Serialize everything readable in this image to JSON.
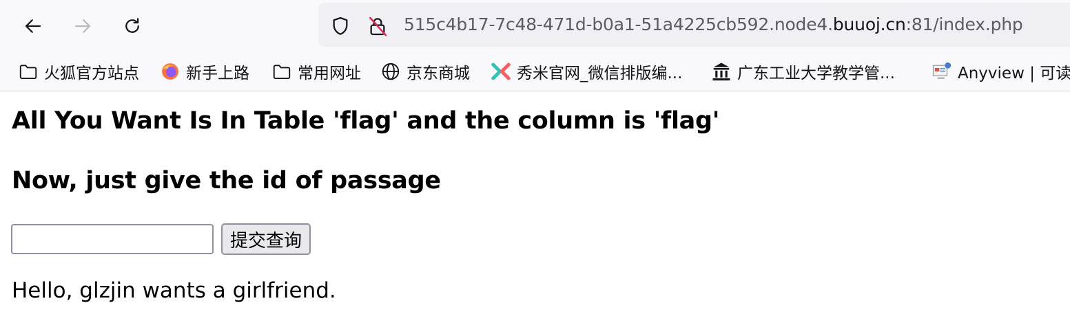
{
  "browser": {
    "url": {
      "prefix": "515c4b17-7c48-471d-b0a1-51a4225cb592.node4.",
      "host": "buuoj.cn",
      "suffix": ":81/index.php"
    },
    "icons": {
      "back": "arrow-left-icon",
      "forward": "arrow-right-icon",
      "reload": "reload-icon",
      "tracking": "shield-icon",
      "insecure": "insecure-lock-icon"
    }
  },
  "bookmarks": [
    {
      "label": "火狐官方站点",
      "icon": "folder-icon"
    },
    {
      "label": "新手上路",
      "icon": "firefox-icon"
    },
    {
      "label": "常用网址",
      "icon": "folder-icon"
    },
    {
      "label": "京东商城",
      "icon": "globe-icon"
    },
    {
      "label": "秀米官网_微信排版编...",
      "icon": "xiumi-icon"
    },
    {
      "label": "广东工业大学教学管...",
      "icon": "university-icon"
    },
    {
      "label": "Anyview | 可读",
      "icon": "anyview-icon"
    }
  ],
  "page": {
    "heading1": "All You Want Is In Table 'flag' and the column is 'flag'",
    "heading2": "Now, just give the id of passage",
    "input_value": "",
    "submit_label": "提交查询",
    "result_text": "Hello, glzjin wants a girlfriend."
  }
}
